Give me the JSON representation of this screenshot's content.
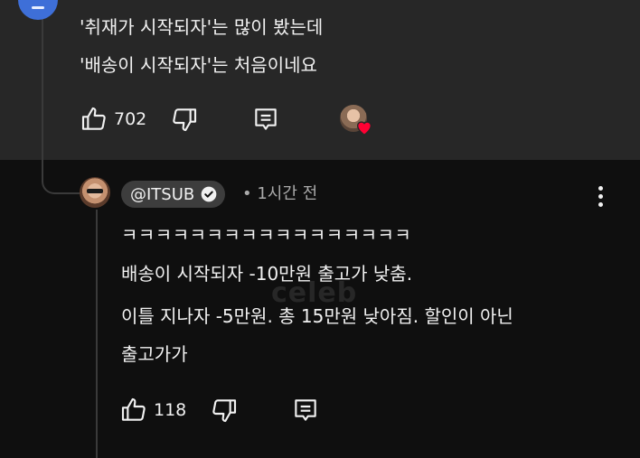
{
  "parent_comment": {
    "text_lines": [
      "'취재가 시작되자'는 많이 봤는데",
      "'배송이 시작되자'는 처음이네요"
    ],
    "like_count": "702"
  },
  "reply": {
    "author_handle": "@ITSUB",
    "verified": true,
    "timestamp": "• 1시간 전",
    "text_lines": [
      "ㅋㅋㅋㅋㅋㅋㅋㅋㅋㅋㅋㅋㅋㅋㅋㅋㅋ",
      "배송이 시작되자 -10만원 출고가 낮춤.",
      "이틀 지나자 -5만원. 총 15만원 낮아짐. 할인이 아닌",
      "출고가가"
    ],
    "like_count": "118"
  },
  "watermark": "celeb",
  "colors": {
    "parent_bg": "#272727",
    "page_bg": "#0f0f0f",
    "heart": "#ff0033",
    "pill_bg": "#3d3d3d"
  },
  "icons": [
    "thumbs-up-icon",
    "thumbs-down-icon",
    "reply-icon",
    "verified-check-icon",
    "more-vert-icon",
    "creator-heart-icon"
  ]
}
